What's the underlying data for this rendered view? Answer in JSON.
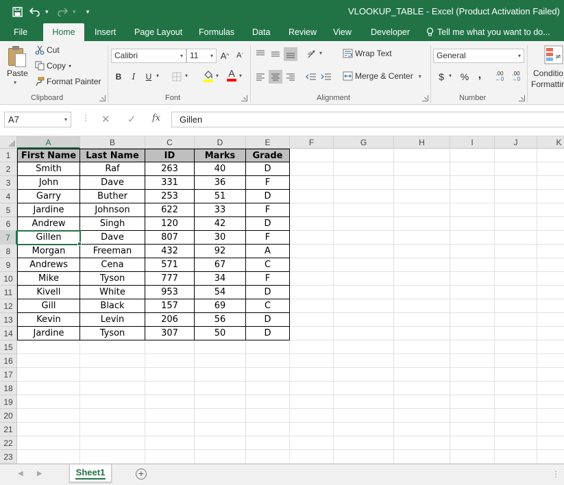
{
  "window": {
    "title": "VLOOKUP_TABLE - Excel (Product Activation Failed)"
  },
  "icons": {
    "save": "save-icon",
    "undo": "undo-icon",
    "redo": "redo-icon",
    "customize": "chevron-down-icon"
  },
  "tabs": [
    {
      "label": "File"
    },
    {
      "label": "Home"
    },
    {
      "label": "Insert"
    },
    {
      "label": "Page Layout"
    },
    {
      "label": "Formulas"
    },
    {
      "label": "Data"
    },
    {
      "label": "Review"
    },
    {
      "label": "View"
    },
    {
      "label": "Developer"
    }
  ],
  "tellme": "Tell me what you want to do...",
  "ribbon": {
    "clipboard": {
      "paste": "Paste",
      "cut": "Cut",
      "copy": "Copy",
      "format_painter": "Format Painter",
      "label": "Clipboard"
    },
    "font": {
      "name": "Calibri",
      "size": "11",
      "grow": "A",
      "shrink": "A",
      "bold": "B",
      "italic": "I",
      "underline": "U",
      "font_color": "A",
      "label": "Font"
    },
    "alignment": {
      "wrap_text": "Wrap Text",
      "merge_center": "Merge & Center",
      "label": "Alignment"
    },
    "number": {
      "format": "General",
      "currency": "$",
      "percent": "%",
      "comma": ",",
      "inc_decimal": ".00",
      "dec_decimal": ".00",
      "label": "Number"
    },
    "styles": {
      "conditional_1": "Conditio",
      "conditional_2": "Formattin"
    }
  },
  "formula_bar": {
    "name_box": "A7",
    "fx": "fx",
    "value": "Gillen"
  },
  "columns": [
    "A",
    "B",
    "C",
    "D",
    "E",
    "F",
    "G",
    "H",
    "I",
    "J",
    "K"
  ],
  "row_numbers": [
    "1",
    "2",
    "3",
    "4",
    "5",
    "6",
    "7",
    "8",
    "9",
    "10",
    "11",
    "12",
    "13",
    "14",
    "15",
    "16",
    "17",
    "18",
    "19",
    "20",
    "21",
    "22",
    "23"
  ],
  "table": {
    "headers": [
      "First Name",
      "Last Name",
      "ID",
      "Marks",
      "Grade"
    ],
    "rows": [
      [
        "Smith",
        "Raf",
        "263",
        "40",
        "D"
      ],
      [
        "John",
        "Dave",
        "331",
        "36",
        "F"
      ],
      [
        "Garry",
        "Buther",
        "253",
        "51",
        "D"
      ],
      [
        "Jardine",
        "Johnson",
        "622",
        "33",
        "F"
      ],
      [
        "Andrew",
        "Singh",
        "120",
        "42",
        "D"
      ],
      [
        "Gillen",
        "Dave",
        "807",
        "30",
        "F"
      ],
      [
        "Morgan",
        "Freeman",
        "432",
        "92",
        "A"
      ],
      [
        "Andrews",
        "Cena",
        "571",
        "67",
        "C"
      ],
      [
        "Mike",
        "Tyson",
        "777",
        "34",
        "F"
      ],
      [
        "Kivell",
        "White",
        "953",
        "54",
        "D"
      ],
      [
        "Gill",
        "Black",
        "157",
        "69",
        "C"
      ],
      [
        "Kevin",
        "Levin",
        "206",
        "56",
        "D"
      ],
      [
        "Jardine",
        "Tyson",
        "307",
        "50",
        "D"
      ]
    ]
  },
  "sheets": {
    "active": "Sheet1",
    "add": "+"
  }
}
